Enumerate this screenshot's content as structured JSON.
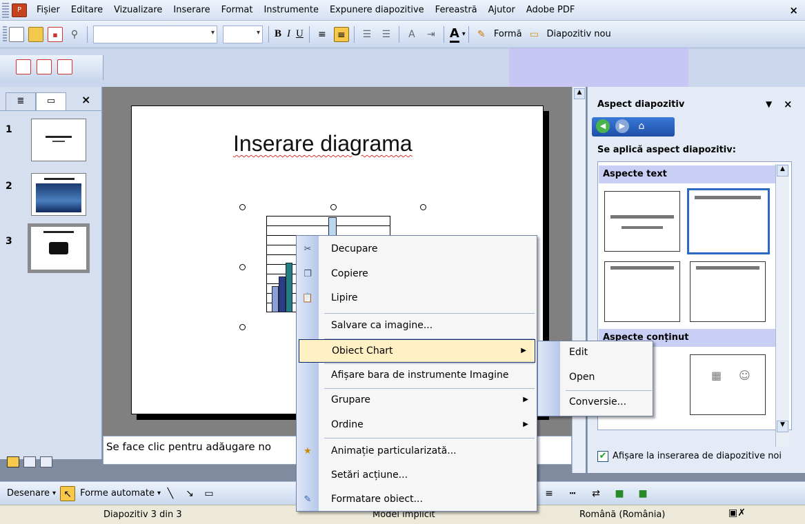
{
  "menubar": {
    "items": [
      "Fișier",
      "Editare",
      "Vizualizare",
      "Inserare",
      "Format",
      "Instrumente",
      "Expunere diapozitive",
      "Fereastră",
      "Ajutor",
      "Adobe PDF"
    ],
    "close": "×"
  },
  "toolbar": {
    "bold": "B",
    "italic": "I",
    "underline": "U",
    "font_color": "A",
    "shape_label": "Formă",
    "new_slide_label": "Diapozitiv nou"
  },
  "slides_panel": {
    "tab_close": "×",
    "slides": [
      {
        "num": "1"
      },
      {
        "num": "2"
      },
      {
        "num": "3"
      }
    ]
  },
  "slide": {
    "title": "Inserare diagrama"
  },
  "notes": {
    "placeholder": "Se face clic pentru adăugare no"
  },
  "task_pane": {
    "title": "Aspect diapozitiv",
    "apply_label": "Se aplică aspect diapozitiv:",
    "section_text": "Aspecte text",
    "section_content": "Aspecte conținut",
    "checkbox_label": "Afișare la inserarea de diapozitive noi",
    "checkbox_checked": true
  },
  "context_menu": {
    "items": [
      {
        "label": "Decupare"
      },
      {
        "label": "Copiere"
      },
      {
        "label": "Lipire"
      },
      {
        "label": "Salvare ca imagine..."
      },
      {
        "label": "Obiect Chart"
      },
      {
        "label": "Afișare bara de instrumente Imagine"
      },
      {
        "label": "Grupare"
      },
      {
        "label": "Ordine"
      },
      {
        "label": "Animație particularizată..."
      },
      {
        "label": "Setări acțiune..."
      },
      {
        "label": "Formatare obiect..."
      }
    ]
  },
  "submenu": {
    "items": [
      "Edit",
      "Open",
      "Conversie..."
    ]
  },
  "drawbar": {
    "draw_label": "Desenare",
    "autoshapes_label": "Forme automate"
  },
  "statusbar": {
    "slide_info": "Diapozitiv 3 din 3",
    "design": "Model implicit",
    "language": "Română (România)"
  }
}
